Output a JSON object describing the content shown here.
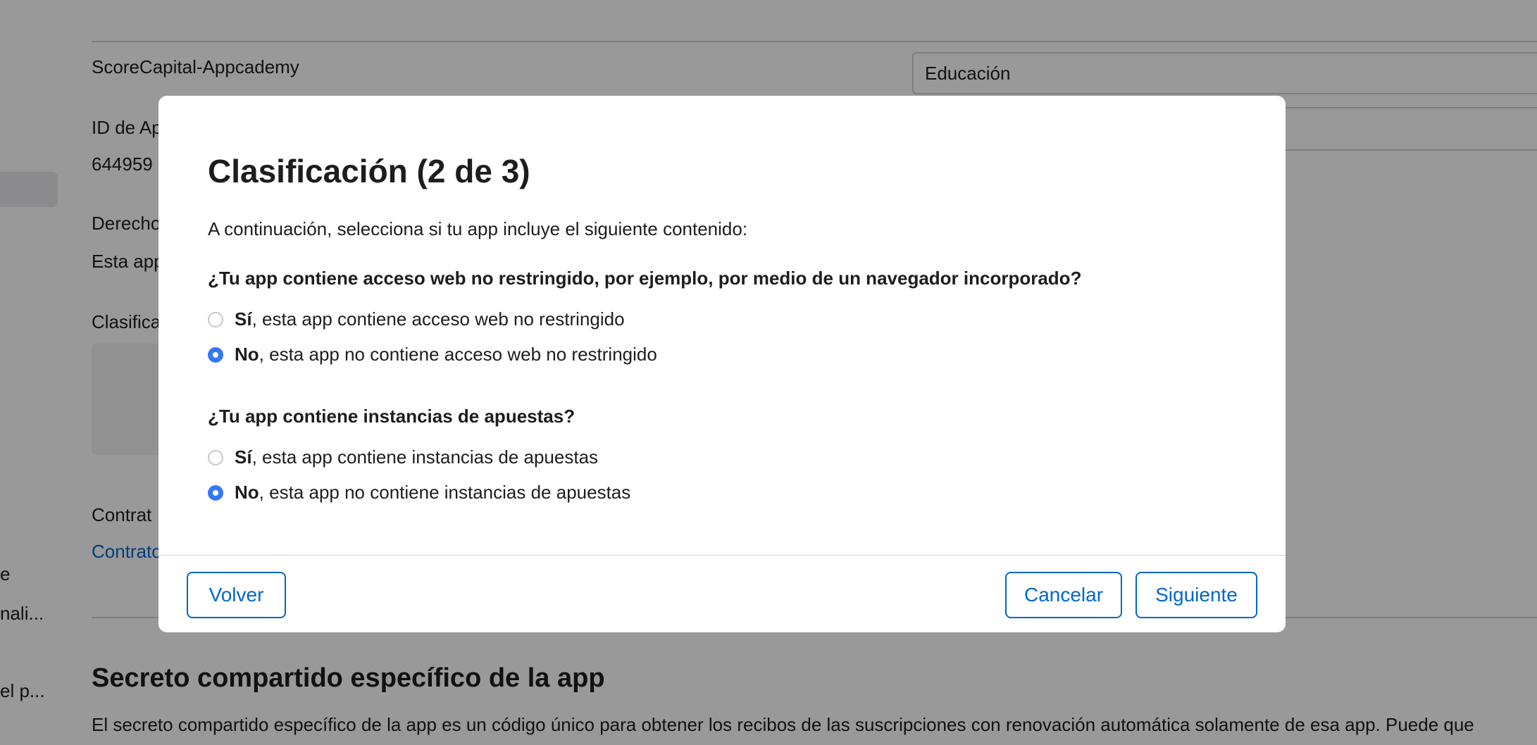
{
  "background": {
    "app_name": "ScoreCapital-Appcademy",
    "category_value": "Educación",
    "apple_id_label": "ID de Ap",
    "apple_id_value": "644959",
    "rights_label": "Derecho",
    "rights_text": "Esta app",
    "rating_label": "Clasifica",
    "contract_label": "Contrat",
    "contract_link": "Contrato",
    "sidebar_items": [
      "e",
      "nali...",
      "el p..."
    ],
    "shared_secret_title": "Secreto compartido específico de la app",
    "shared_secret_text": "El secreto compartido específico de la app es un código único para obtener los recibos de las suscripciones con renovación automática solamente de esa app. Puede que"
  },
  "modal": {
    "title": "Clasificación (2 de 3)",
    "intro": "A continuación, selecciona si tu app incluye el siguiente contenido:",
    "questions": [
      {
        "question": "¿Tu app contiene acceso web no restringido, por ejemplo, por medio de un navegador incorporado?",
        "options": [
          {
            "strong": "Sí",
            "text": ", esta app contiene acceso web no restringido",
            "checked": false
          },
          {
            "strong": "No",
            "text": ", esta app no contiene acceso web no restringido",
            "checked": true
          }
        ]
      },
      {
        "question": "¿Tu app contiene instancias de apuestas?",
        "options": [
          {
            "strong": "Sí",
            "text": ", esta app contiene instancias de apuestas",
            "checked": false
          },
          {
            "strong": "No",
            "text": ", esta app no contiene instancias de apuestas",
            "checked": true
          }
        ]
      }
    ],
    "buttons": {
      "back": "Volver",
      "cancel": "Cancelar",
      "next": "Siguiente"
    }
  },
  "colors": {
    "accent": "#0066cc",
    "radio_selected": "#3478f6",
    "overlay": "rgba(0,0,0,0.40)"
  }
}
